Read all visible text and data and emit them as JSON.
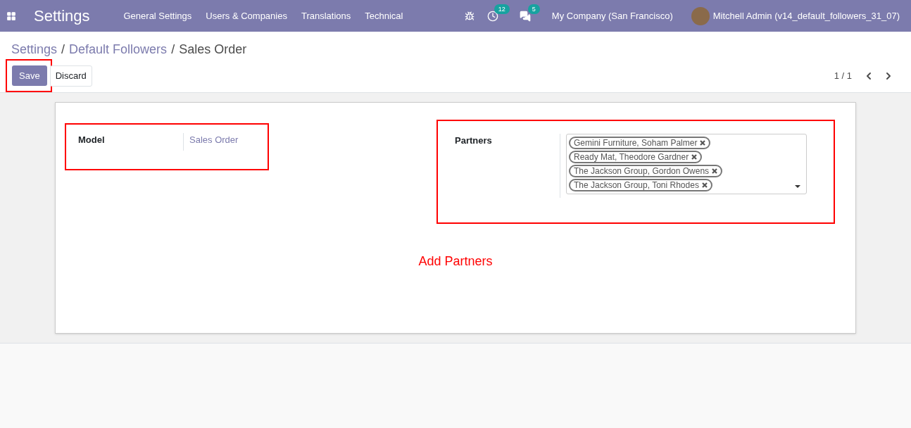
{
  "navbar": {
    "app_title": "Settings",
    "menu": [
      {
        "label": "General Settings"
      },
      {
        "label": "Users & Companies"
      },
      {
        "label": "Translations"
      },
      {
        "label": "Technical"
      }
    ],
    "activity_count": "12",
    "message_count": "5",
    "company": "My Company (San Francisco)",
    "user": "Mitchell Admin (v14_default_followers_31_07)"
  },
  "breadcrumb": [
    {
      "label": "Settings",
      "link": true
    },
    {
      "label": "Default Followers",
      "link": true
    },
    {
      "label": "Sales Order",
      "link": false
    }
  ],
  "breadcrumb_separator": "/",
  "buttons": [
    {
      "label": "Save",
      "kind": "primary"
    },
    {
      "label": "Discard",
      "kind": "secondary"
    }
  ],
  "pager": "1 / 1",
  "form": {
    "model_label": "Model",
    "model_value": "Sales Order",
    "partners_label": "Partners",
    "partners": [
      {
        "label": "Gemini Furniture, Soham Palmer"
      },
      {
        "label": "Ready Mat, Theodore Gardner"
      },
      {
        "label": "The Jackson Group, Gordon Owens"
      },
      {
        "label": "The Jackson Group, Toni Rhodes"
      }
    ]
  },
  "annotation": "Add Partners"
}
